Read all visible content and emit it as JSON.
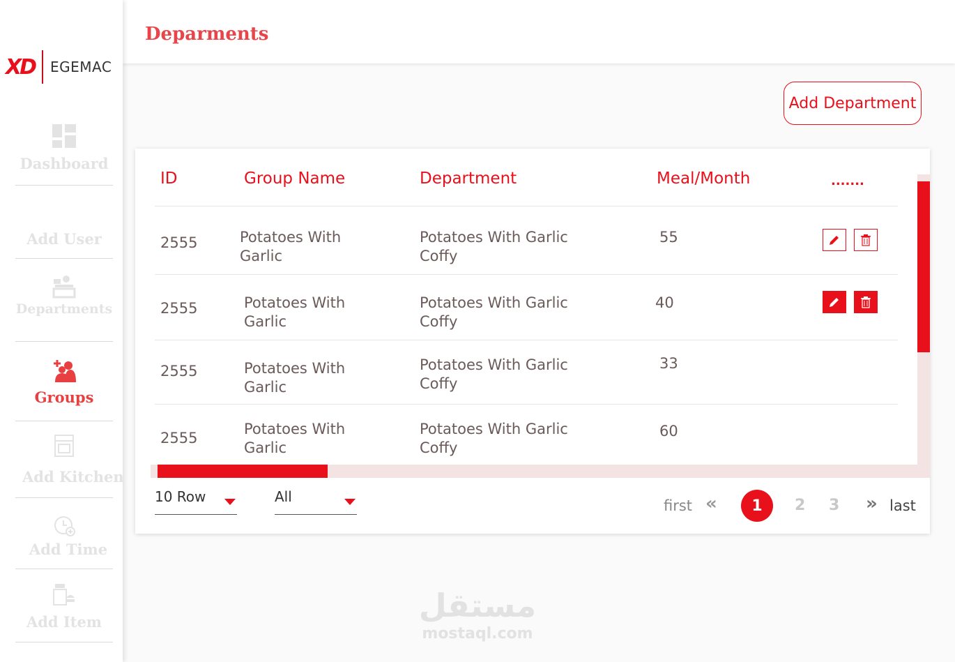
{
  "brand": {
    "mark": "XD",
    "name": "EGEMAC"
  },
  "sidebar": {
    "items": [
      {
        "label": "Dashboard",
        "icon": "dashboard-icon"
      },
      {
        "label": "Add User",
        "icon": "add-user-icon"
      },
      {
        "label": "Departments",
        "icon": "departments-icon"
      },
      {
        "label": "Groups",
        "icon": "groups-icon",
        "active": true
      },
      {
        "label": "Add Kitchen",
        "icon": "kitchen-icon"
      },
      {
        "label": "Add Time",
        "icon": "alarm-clock-icon"
      },
      {
        "label": "Add Item",
        "icon": "food-item-icon"
      }
    ]
  },
  "header": {
    "title": "Deparments"
  },
  "actions": {
    "add_department": "Add Department"
  },
  "table": {
    "columns": [
      "ID",
      "Group Name",
      "Department",
      "Meal/Month",
      "......."
    ],
    "rows": [
      {
        "id": "2555",
        "group_line1": "Potatoes With",
        "group_line2": "Garlic",
        "dept_line1": "Potatoes With Garlic",
        "dept_line2": "Coffy",
        "meal": "55",
        "actions_style": "outline"
      },
      {
        "id": "2555",
        "group_line1": "Potatoes With",
        "group_line2": "Garlic",
        "dept_line1": "Potatoes With Garlic",
        "dept_line2": "Coffy",
        "meal": "40",
        "actions_style": "filled"
      },
      {
        "id": "2555",
        "group_line1": "Potatoes With",
        "group_line2": "Garlic",
        "dept_line1": "Potatoes With Garlic",
        "dept_line2": "Coffy",
        "meal": "33"
      },
      {
        "id": "2555",
        "group_line1": "Potatoes With",
        "group_line2": "Garlic",
        "dept_line1": "Potatoes With Garlic",
        "dept_line2": "Coffy",
        "meal": "60"
      }
    ]
  },
  "footer": {
    "rows_select": "10 Row",
    "filter_select": "All",
    "pagination": {
      "first": "first",
      "last": "last",
      "pages": [
        "1",
        "2",
        "3"
      ],
      "current": "1",
      "prev_icon": "«",
      "next_icon": "»"
    }
  },
  "watermark": {
    "arabic": "مستقل",
    "latin": "mostaql.com"
  },
  "colors": {
    "accent": "#e8101a",
    "title": "#e8454a",
    "inactive_nav": "#e3e3e3",
    "track": "#f3e3e3"
  }
}
